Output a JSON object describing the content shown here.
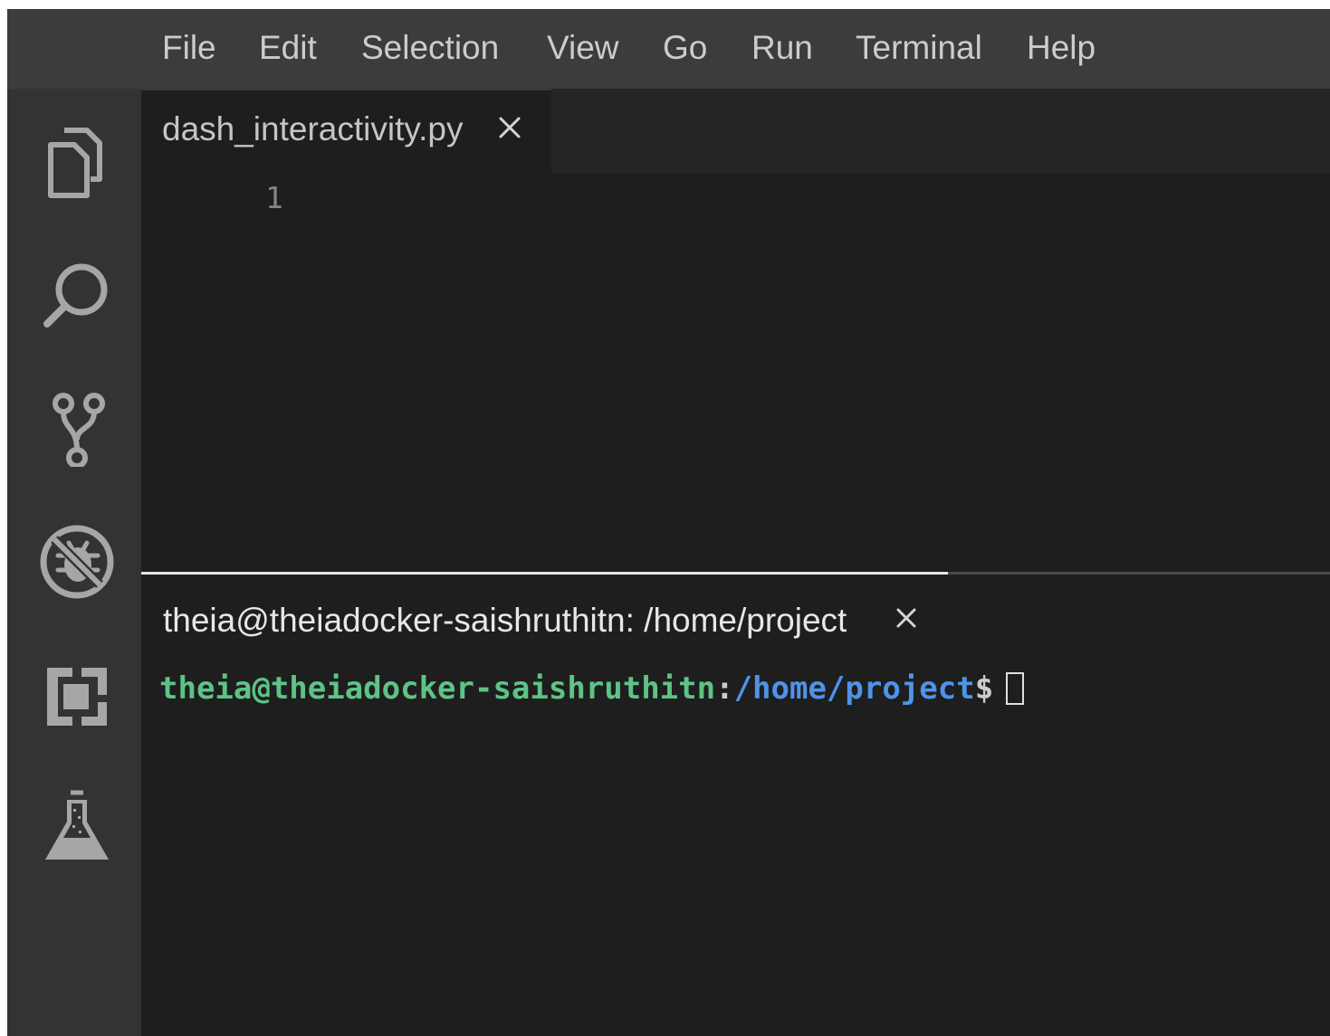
{
  "menubar": {
    "items": [
      "File",
      "Edit",
      "Selection",
      "View",
      "Go",
      "Run",
      "Terminal",
      "Help"
    ]
  },
  "activitybar": {
    "icons": [
      "explorer-icon",
      "search-icon",
      "source-control-icon",
      "debug-icon",
      "extensions-icon",
      "lab-flask-icon"
    ]
  },
  "editor": {
    "tab": {
      "filename": "dash_interactivity.py",
      "close_icon": "close-icon"
    },
    "line_numbers": [
      "1"
    ]
  },
  "panel": {
    "terminal_tab": {
      "title": "theia@theiadocker-saishruthitn: /home/project",
      "close_icon": "close-icon"
    },
    "terminal": {
      "user_host": "theia@theiadocker-saishruthitn",
      "separator": ":",
      "cwd": "/home/project",
      "prompt_symbol": "$"
    }
  },
  "colors": {
    "menubar_bg": "#3c3c3c",
    "activitybar_bg": "#333333",
    "editor_bg": "#1e1e1e",
    "prompt_user_host": "#5ec386",
    "prompt_cwd": "#4f93e8"
  }
}
